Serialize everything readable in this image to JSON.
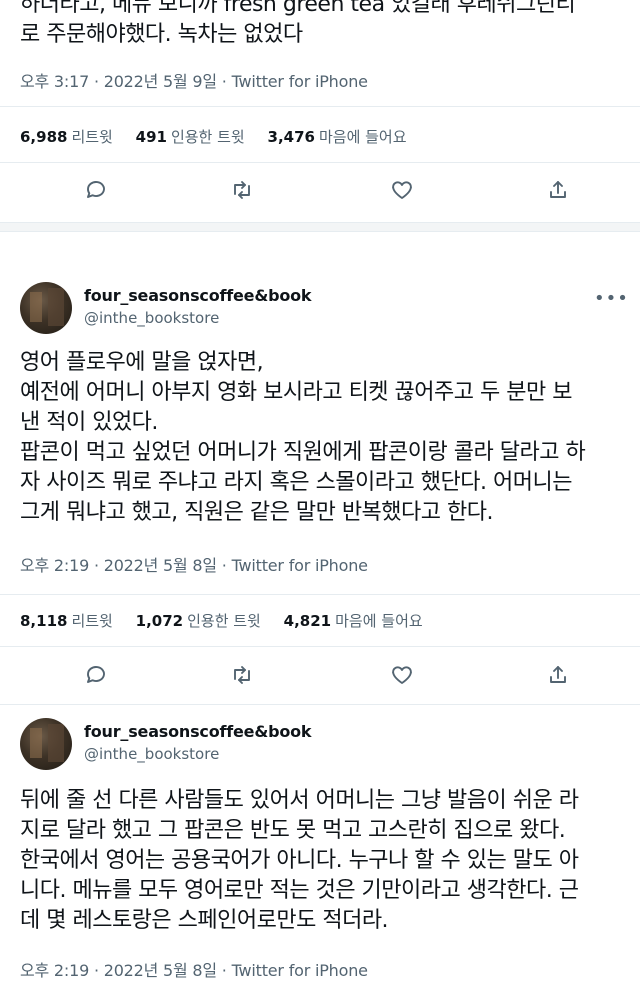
{
  "tweet0": {
    "text_lines": [
      "하더라고, 메뉴 보니까 fresh green tea 있길래 후레쉬그린티",
      "로 주문해야했다. 녹차는 없었다"
    ],
    "meta": "오후 3:17 · 2022년 5월 9일 · Twitter for iPhone",
    "stats": {
      "retweets_count": "6,988",
      "retweets_label": "리트윗",
      "quotes_count": "491",
      "quotes_label": "인용한 트윗",
      "likes_count": "3,476",
      "likes_label": "마음에 들어요"
    }
  },
  "tweet1": {
    "name": "four_seasonscoffee&book",
    "handle": "@inthe_bookstore",
    "more": "•••",
    "text_lines": [
      "영어 플로우에 말을 얹자면,",
      "예전에 어머니 아부지 영화 보시라고 티켓 끊어주고 두 분만 보",
      "낸 적이 있었다.",
      "팝콘이 먹고 싶었던 어머니가 직원에게 팝콘이랑 콜라 달라고 하",
      "자 사이즈 뭐로 주냐고 라지 혹은 스몰이라고 했단다. 어머니는",
      "그게 뭐냐고 했고, 직원은 같은 말만 반복했다고 한다."
    ],
    "meta": "오후 2:19 · 2022년 5월 8일 · Twitter for iPhone",
    "stats": {
      "retweets_count": "8,118",
      "retweets_label": "리트윗",
      "quotes_count": "1,072",
      "quotes_label": "인용한 트윗",
      "likes_count": "4,821",
      "likes_label": "마음에 들어요"
    }
  },
  "tweet2": {
    "name": "four_seasonscoffee&book",
    "handle": "@inthe_bookstore",
    "more": "•••",
    "text_lines": [
      "뒤에 줄 선 다른 사람들도 있어서 어머니는 그냥 발음이 쉬운 라",
      "지로 달라 했고 그 팝콘은 반도 못 먹고 고스란히 집으로 왔다.",
      "한국에서 영어는 공용국어가 아니다. 누구나 할 수 있는 말도 아",
      "니다. 메뉴를 모두 영어로만 적는 것은 기만이라고 생각한다. 근",
      "데 몇 레스토랑은 스페인어로만도 적더라."
    ],
    "meta": "오후 2:19 · 2022년 5월 8일 · Twitter for iPhone"
  },
  "icons": [
    "reply-icon",
    "retweet-icon",
    "like-icon",
    "share-icon"
  ]
}
